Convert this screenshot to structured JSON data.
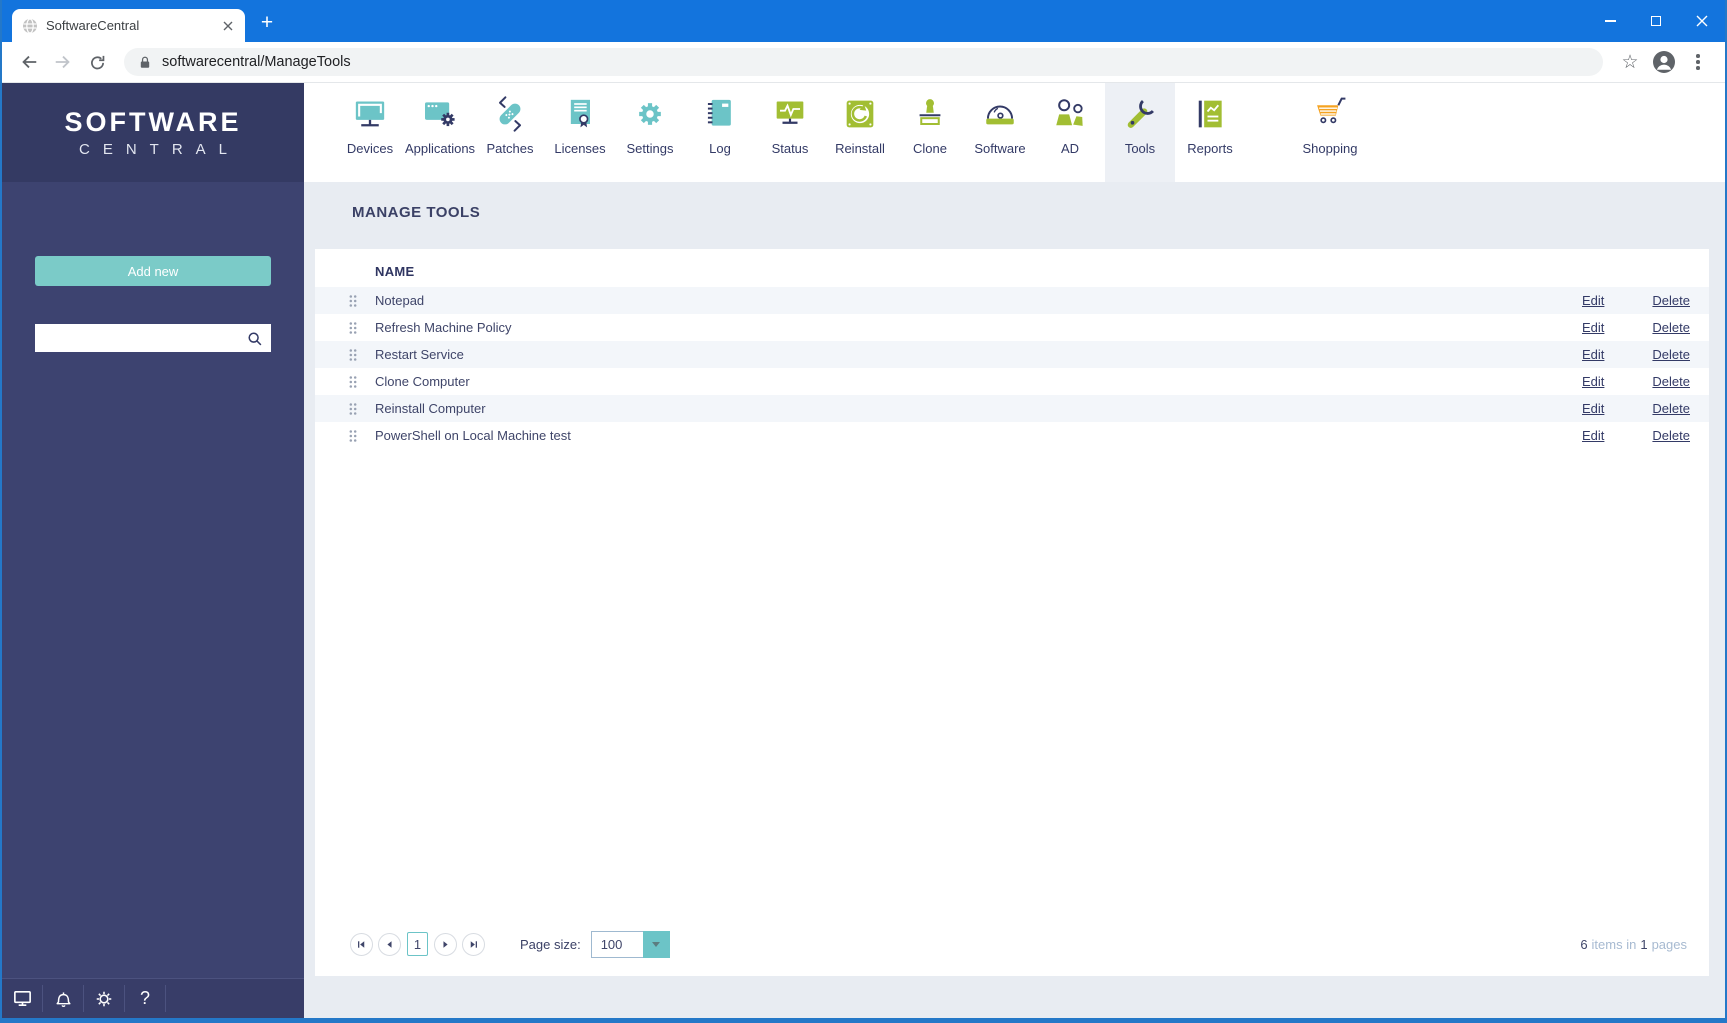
{
  "browser": {
    "tab_title": "SoftwareCentral",
    "new_tab_label": "+",
    "url": "softwarecentral/ManageTools"
  },
  "brand": {
    "line1": "SOFTWARE",
    "line2": "CENTRAL"
  },
  "sidebar": {
    "add_new_label": "Add new",
    "search_value": "",
    "footer_icons": [
      "monitor-icon",
      "bell-icon",
      "gear-icon",
      "help-icon"
    ],
    "help_glyph": "?"
  },
  "nav": {
    "items": [
      {
        "id": "devices",
        "label": "Devices",
        "icon": "i-devices",
        "active": false,
        "gap_before": false
      },
      {
        "id": "applications",
        "label": "Applications",
        "icon": "i-applications",
        "active": false,
        "gap_before": false
      },
      {
        "id": "patches",
        "label": "Patches",
        "icon": "i-patches",
        "active": false,
        "gap_before": false
      },
      {
        "id": "licenses",
        "label": "Licenses",
        "icon": "i-licenses",
        "active": false,
        "gap_before": false
      },
      {
        "id": "settings",
        "label": "Settings",
        "icon": "i-settings",
        "active": false,
        "gap_before": false
      },
      {
        "id": "log",
        "label": "Log",
        "icon": "i-log",
        "active": false,
        "gap_before": false
      },
      {
        "id": "status",
        "label": "Status",
        "icon": "i-status",
        "active": false,
        "gap_before": false
      },
      {
        "id": "reinstall",
        "label": "Reinstall",
        "icon": "i-reinstall",
        "active": false,
        "gap_before": false
      },
      {
        "id": "clone",
        "label": "Clone",
        "icon": "i-clone",
        "active": false,
        "gap_before": false
      },
      {
        "id": "software",
        "label": "Software",
        "icon": "i-software",
        "active": false,
        "gap_before": false
      },
      {
        "id": "ad",
        "label": "AD",
        "icon": "i-ad",
        "active": false,
        "gap_before": false
      },
      {
        "id": "tools",
        "label": "Tools",
        "icon": "i-tools",
        "active": true,
        "gap_before": false
      },
      {
        "id": "reports",
        "label": "Reports",
        "icon": "i-reports",
        "active": false,
        "gap_before": false
      },
      {
        "id": "shopping",
        "label": "Shopping",
        "icon": "i-shopping",
        "active": false,
        "gap_before": true
      }
    ]
  },
  "main": {
    "title": "MANAGE TOOLS",
    "table": {
      "columns": [
        "NAME"
      ],
      "rows": [
        {
          "name": "Notepad"
        },
        {
          "name": "Refresh Machine Policy"
        },
        {
          "name": "Restart Service"
        },
        {
          "name": "Clone Computer"
        },
        {
          "name": "Reinstall Computer"
        },
        {
          "name": "PowerShell on Local Machine test"
        }
      ],
      "row_actions": {
        "edit": "Edit",
        "delete": "Delete"
      }
    },
    "pagination": {
      "current_page": "1",
      "page_size_label": "Page size:",
      "page_size_value": "100",
      "summary": {
        "count": "6",
        "middle": "items in",
        "pages": "1",
        "suffix": "pages"
      }
    }
  },
  "colors": {
    "titlebar_blue": "#1374dd",
    "window_border_blue": "#2478c8",
    "sidebar_navy": "#3d4370",
    "sidebar_header_navy": "#343a63",
    "accent_teal": "#6cc4c7",
    "button_teal": "#7bcbc8",
    "accent_green": "#a2be33",
    "accent_navy": "#333a66",
    "accent_orange": "#f5a322",
    "content_bg": "#e8ecf2",
    "row_alt_bg": "#f3f6fa"
  }
}
